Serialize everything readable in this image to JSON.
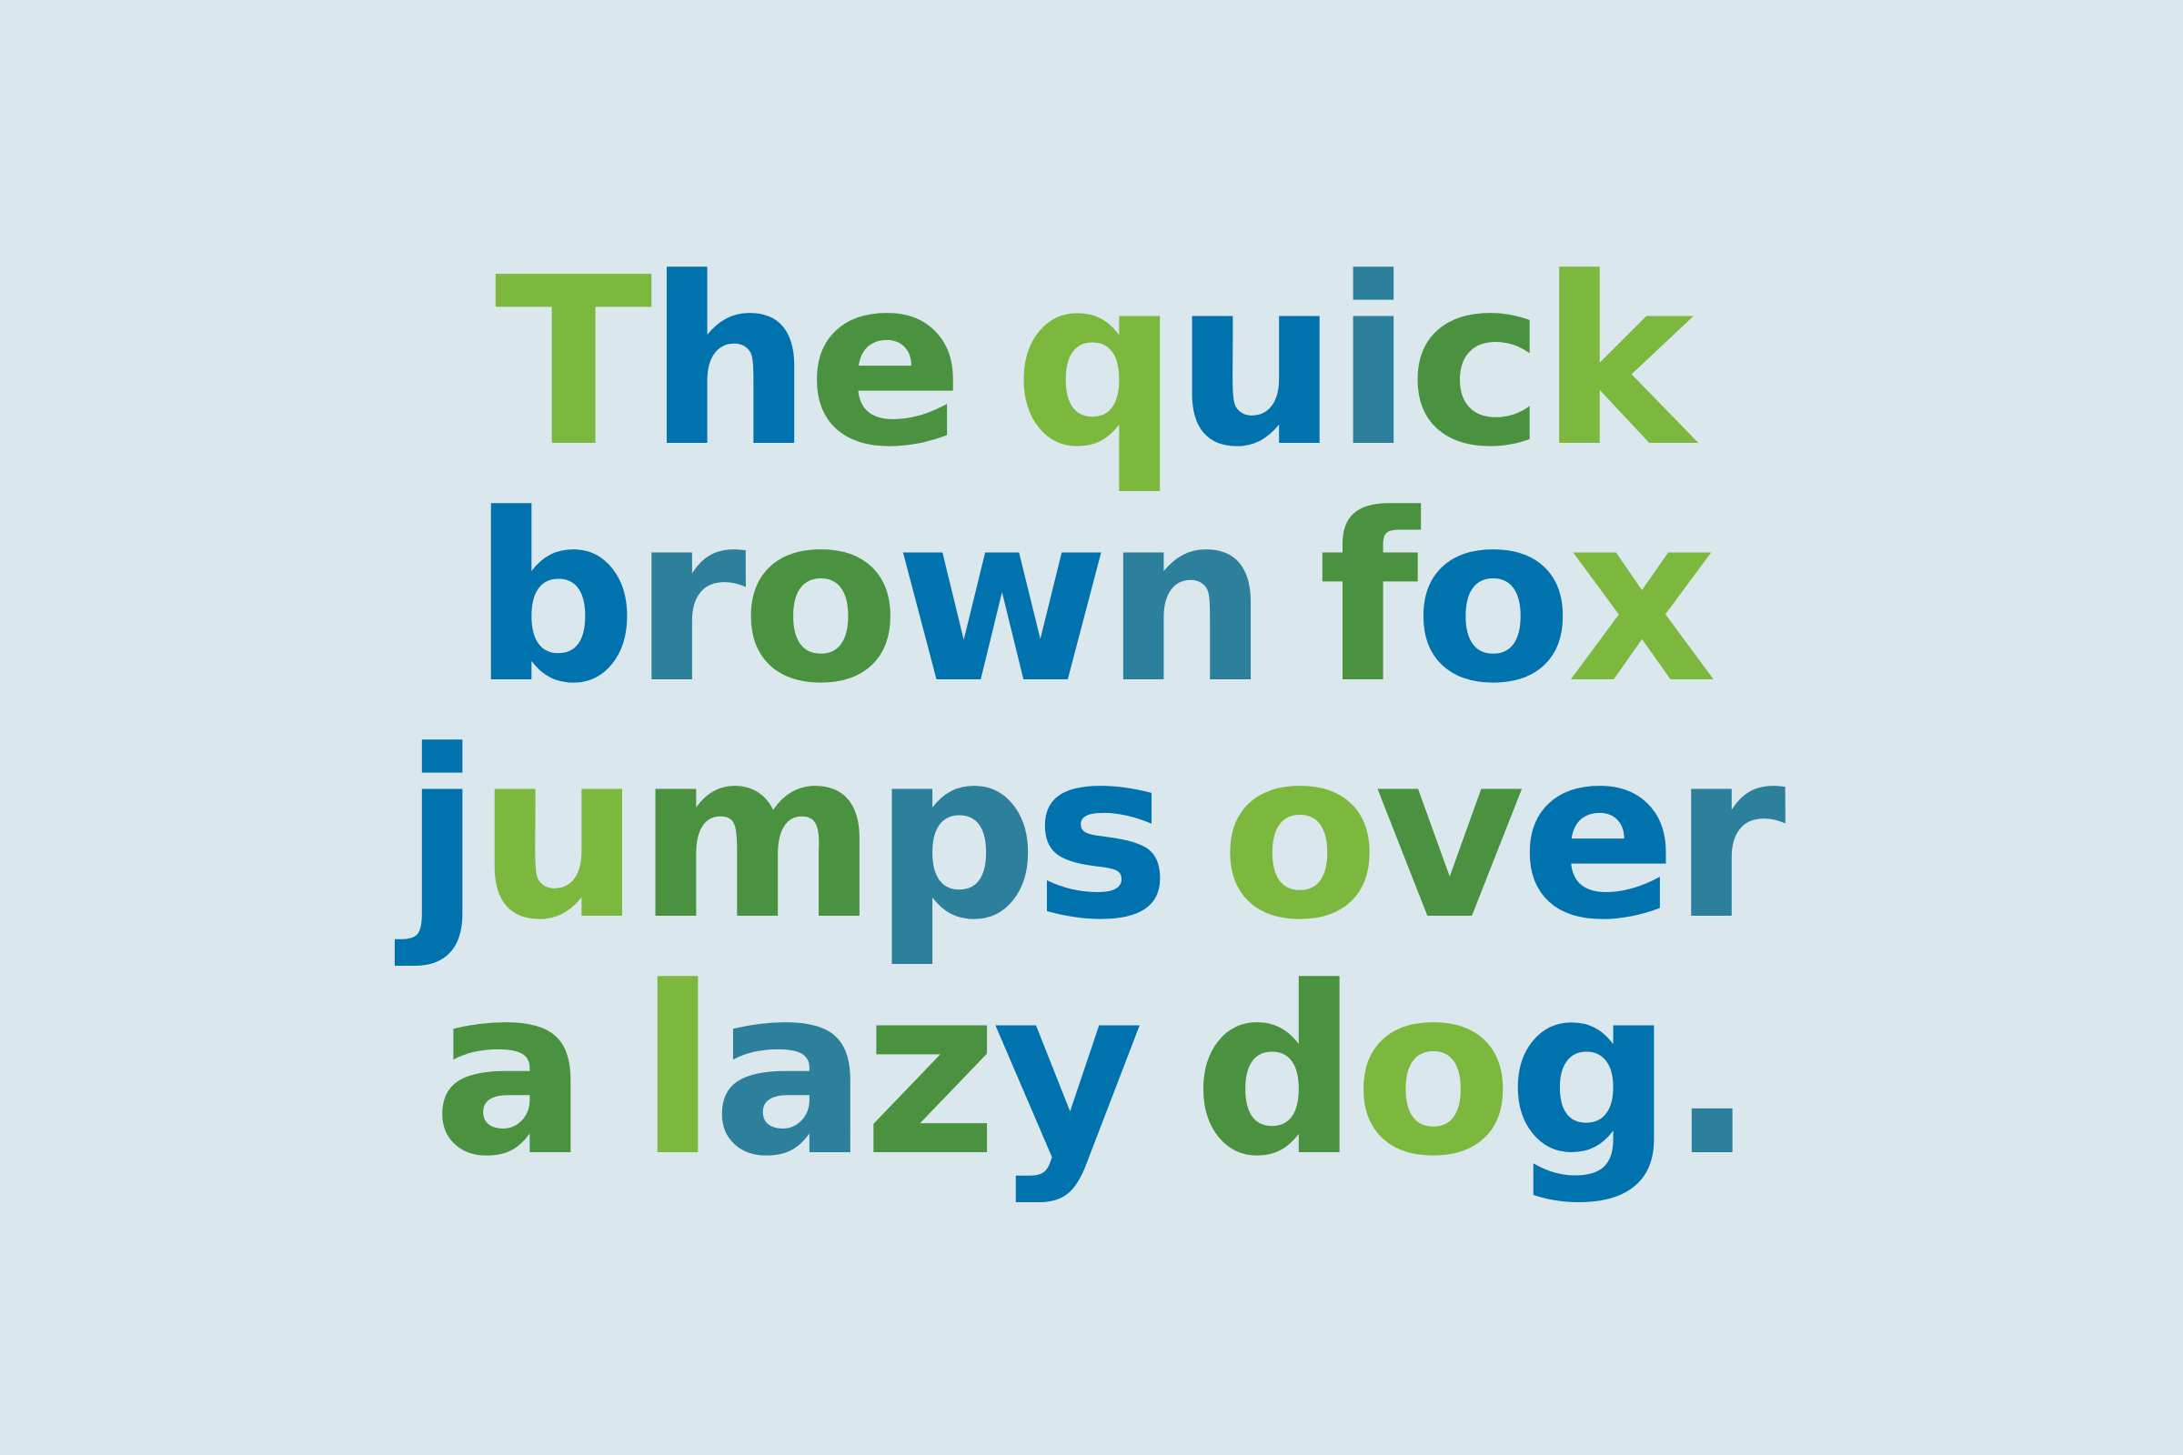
{
  "colors": {
    "background": "#dae7ed",
    "lime": "#7db83e",
    "blue": "#0072ad",
    "teal": "#2c809b",
    "green": "#4a9240"
  },
  "lines": [
    {
      "words": [
        {
          "letters": [
            {
              "t": "T",
              "c": "lime"
            },
            {
              "t": "h",
              "c": "blue"
            },
            {
              "t": "e",
              "c": "green"
            }
          ]
        },
        {
          "letters": [
            {
              "t": "q",
              "c": "lime"
            },
            {
              "t": "u",
              "c": "blue"
            },
            {
              "t": "i",
              "c": "teal"
            },
            {
              "t": "c",
              "c": "green"
            },
            {
              "t": "k",
              "c": "lime"
            }
          ]
        }
      ]
    },
    {
      "words": [
        {
          "letters": [
            {
              "t": "b",
              "c": "blue"
            },
            {
              "t": "r",
              "c": "teal"
            },
            {
              "t": "o",
              "c": "green"
            },
            {
              "t": "w",
              "c": "blue"
            },
            {
              "t": "n",
              "c": "teal"
            }
          ]
        },
        {
          "letters": [
            {
              "t": "f",
              "c": "green"
            },
            {
              "t": "o",
              "c": "blue"
            },
            {
              "t": "x",
              "c": "lime"
            }
          ]
        }
      ]
    },
    {
      "words": [
        {
          "letters": [
            {
              "t": "j",
              "c": "blue"
            },
            {
              "t": "u",
              "c": "lime"
            },
            {
              "t": "m",
              "c": "green"
            },
            {
              "t": "p",
              "c": "teal"
            },
            {
              "t": "s",
              "c": "blue"
            }
          ]
        },
        {
          "letters": [
            {
              "t": "o",
              "c": "lime"
            },
            {
              "t": "v",
              "c": "green"
            },
            {
              "t": "e",
              "c": "blue"
            },
            {
              "t": "r",
              "c": "teal"
            }
          ]
        }
      ]
    },
    {
      "words": [
        {
          "letters": [
            {
              "t": "a",
              "c": "green"
            }
          ]
        },
        {
          "letters": [
            {
              "t": "l",
              "c": "lime"
            },
            {
              "t": "a",
              "c": "teal"
            },
            {
              "t": "z",
              "c": "green"
            },
            {
              "t": "y",
              "c": "blue"
            }
          ]
        },
        {
          "letters": [
            {
              "t": "d",
              "c": "green"
            },
            {
              "t": "o",
              "c": "lime"
            },
            {
              "t": "g",
              "c": "blue"
            },
            {
              "t": ".",
              "c": "teal"
            }
          ]
        }
      ]
    }
  ]
}
